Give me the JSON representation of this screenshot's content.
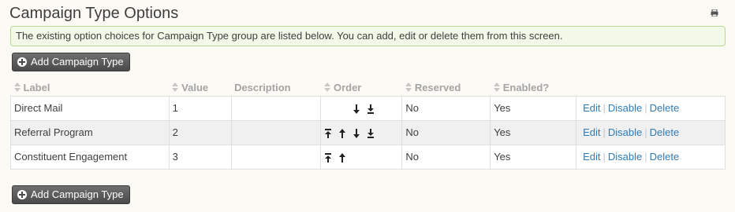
{
  "page": {
    "title": "Campaign Type Options",
    "notice": "The existing option choices for Campaign Type group are listed below. You can add, edit or delete them from this screen."
  },
  "buttons": {
    "add_top": "Add Campaign Type",
    "add_bottom": "Add Campaign Type"
  },
  "table": {
    "headers": {
      "label": "Label",
      "value": "Value",
      "description": "Description",
      "order": "Order",
      "reserved": "Reserved",
      "enabled": "Enabled?"
    },
    "rows": [
      {
        "label": "Direct Mail",
        "value": "1",
        "description": "",
        "order_controls": [
          "move-down",
          "move-bottom"
        ],
        "reserved": "No",
        "enabled": "Yes",
        "actions": [
          "Edit",
          "Disable",
          "Delete"
        ]
      },
      {
        "label": "Referral Program",
        "value": "2",
        "description": "",
        "order_controls": [
          "move-top",
          "move-up",
          "move-down",
          "move-bottom"
        ],
        "reserved": "No",
        "enabled": "Yes",
        "actions": [
          "Edit",
          "Disable",
          "Delete"
        ]
      },
      {
        "label": "Constituent Engagement",
        "value": "3",
        "description": "",
        "order_controls": [
          "move-top",
          "move-up"
        ],
        "reserved": "No",
        "enabled": "Yes",
        "actions": [
          "Edit",
          "Disable",
          "Delete"
        ]
      }
    ]
  },
  "icons": {
    "print": "print-icon",
    "add": "plus-circle-icon",
    "sort": "sort-icon"
  },
  "colors": {
    "link": "#2e7bb6",
    "notice_bg": "#f2f9e8",
    "notice_border": "#b8d98f",
    "button_bg": "#4a4a4a"
  }
}
